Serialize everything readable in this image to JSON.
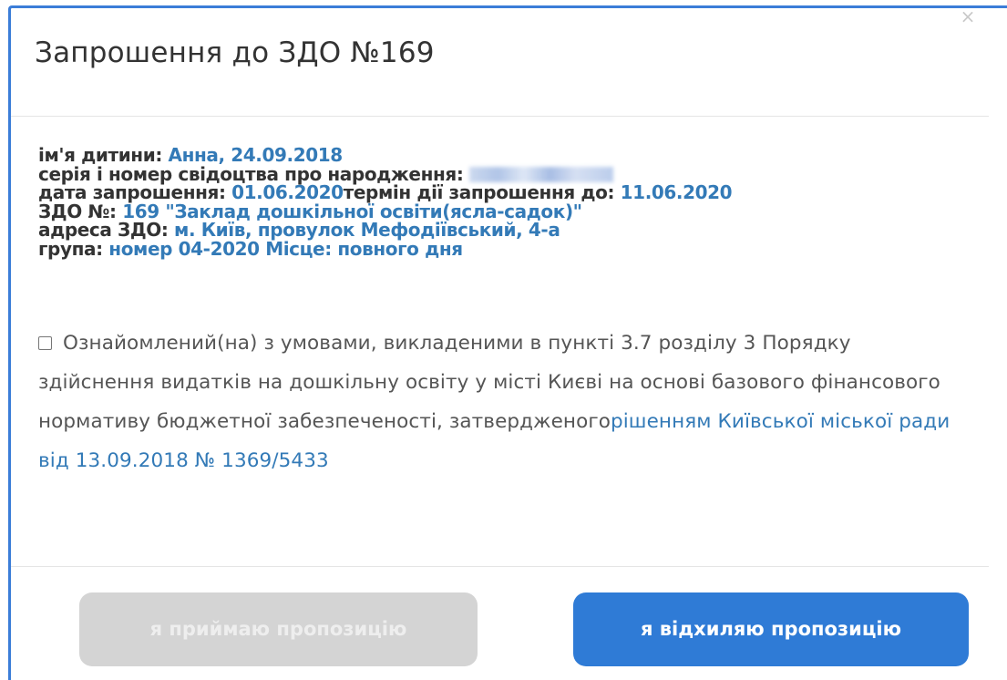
{
  "dialog": {
    "title": "Запрошення до ЗДО №169",
    "close_label": "×"
  },
  "info": {
    "child_label": "ім'я дитини: ",
    "child_value": "Анна, 24.09.2018",
    "certificate_label": "серія і номер свідоцтва про народження: ",
    "invite_date_label": "дата запрошення: ",
    "invite_date_value": "01.06.2020",
    "valid_until_label": "термін дії запрошення до: ",
    "valid_until_value": "11.06.2020",
    "zdo_label": "ЗДО №: ",
    "zdo_value": "169 \"Заклад дошкільної освіти(ясла-садок)\"",
    "address_label": "адреса ЗДО: ",
    "address_value": "м. Київ, провулок Мефодіївський, 4-а",
    "group_label": "група: ",
    "group_value": "номер 04-2020 Місце: повного дня"
  },
  "agreement": {
    "checked": false,
    "text": "Ознайомлений(на) з умовами, викладеними в пункті 3.7 розділу 3 Порядку здійснення видатків на дошкільну освіту у місті Києві на основі базового фінансового нормативу бюджетної забезпеченості, затвердженого",
    "link_text": "рішенням Київської міської ради від 13.09.2018 № 1369/5433"
  },
  "buttons": {
    "accept_label": "я приймаю пропозицію",
    "accept_disabled": true,
    "reject_label": "я відхиляю пропозицію"
  },
  "colors": {
    "accent": "#337ab7",
    "reject_button": "#2f7bd6",
    "disabled_button": "#d4d4d4",
    "modal_border": "#3b7dd8"
  }
}
